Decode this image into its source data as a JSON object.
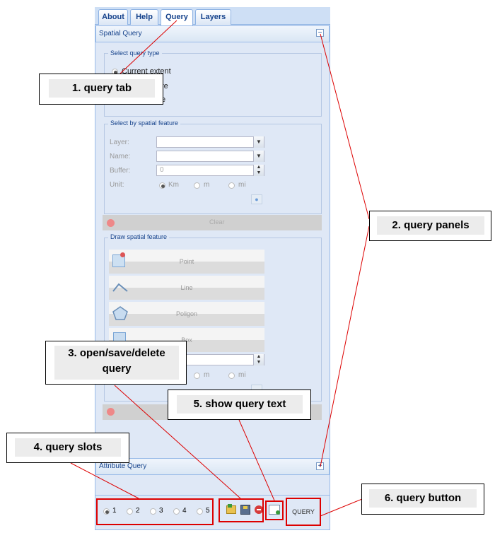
{
  "tabs": [
    "About",
    "Help",
    "Query",
    "Layers"
  ],
  "active_tab": "Query",
  "spatial_query": {
    "header": "Spatial Query",
    "collapse_symbol": "−",
    "select_query_type": {
      "legend": "Select query type",
      "options": [
        "Current extent",
        "re",
        "e"
      ]
    },
    "select_by_feature": {
      "legend": "Select by spatial feature",
      "layer_label": "Layer:",
      "name_label": "Name:",
      "buffer_label": "Buffer:",
      "buffer_value": "0",
      "unit_label": "Unit:",
      "units": [
        "Km",
        "m",
        "mi"
      ],
      "clear_label": "Clear"
    },
    "draw_feature": {
      "legend": "Draw spatial feature",
      "buttons": [
        "Point",
        "Line",
        "Poligon",
        "Box"
      ],
      "units": [
        "m",
        "mi"
      ]
    }
  },
  "attribute_query": {
    "header": "Attribute Query",
    "expand_symbol": "+"
  },
  "slots": [
    "1",
    "2",
    "3",
    "4",
    "5"
  ],
  "query_button": "QUERY",
  "annotations": {
    "a1": "1.  query tab",
    "a2": "2.  query panels",
    "a3_line1": "3.  open/save/delete",
    "a3_line2": "query",
    "a4": "4.  query slots",
    "a5": "5.  show query text",
    "a6": "6.  query button"
  },
  "colors": {
    "annotation_red": "#dd0000",
    "panel_blue": "#dfe8f6",
    "header_text": "#15428b"
  }
}
